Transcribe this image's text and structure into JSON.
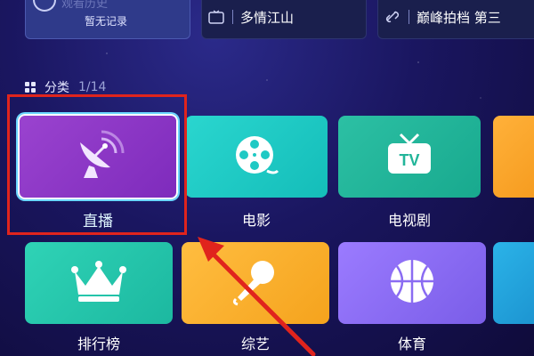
{
  "recent": {
    "history_title_faded": "观看历史",
    "history_sub": "暂无记录",
    "shows": [
      {
        "icon": "tv-small-icon",
        "title": "多情江山"
      },
      {
        "icon": "link-icon",
        "title": "巅峰拍档 第三"
      }
    ]
  },
  "category": {
    "label": "分类",
    "current": "1",
    "total": "/14"
  },
  "tiles": [
    {
      "label": "直播",
      "icon": "satellite-dish-icon"
    },
    {
      "label": "电影",
      "icon": "film-reel-icon"
    },
    {
      "label": "电视剧",
      "icon": "tv-icon"
    },
    {
      "label": "排行榜",
      "icon": "crown-icon"
    },
    {
      "label": "综艺",
      "icon": "microphone-icon"
    },
    {
      "label": "体育",
      "icon": "basketball-icon"
    }
  ],
  "colors": {
    "live": "#8a36c7",
    "movie": "#1fc9c4",
    "tv": "#22b599",
    "rank": "#25c6ab",
    "variety": "#f7ad2e",
    "sports": "#8a6cf2",
    "annotation": "#e0241d"
  }
}
